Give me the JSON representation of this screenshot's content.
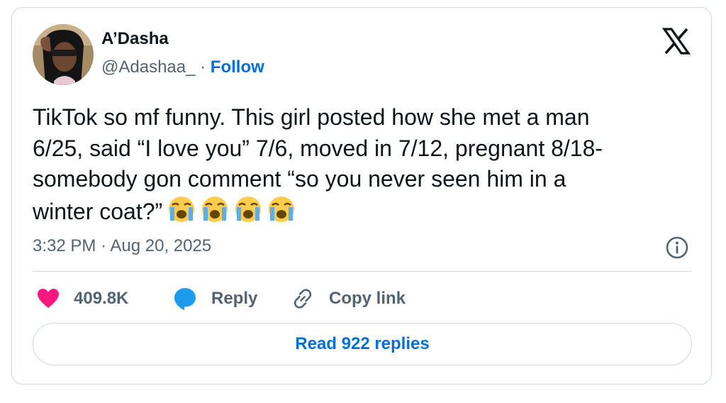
{
  "author": {
    "display_name": "A’Dasha",
    "handle": "@Adashaa_",
    "separator": " · ",
    "follow_label": "Follow"
  },
  "brand_icon": "x-logo-icon",
  "tweet": {
    "text": "TikTok so mf funny. This girl posted how she met a man\n6/25, said “I love you” 7/6, moved in 7/12, pregnant 8/18-\nsomebody gon comment “so you never seen him in a\nwinter coat?”",
    "emojis": [
      "loudly-crying-face-icon",
      "loudly-crying-face-icon",
      "loudly-crying-face-icon",
      "loudly-crying-face-icon"
    ],
    "timestamp": "3:32 PM · Aug 20, 2025"
  },
  "actions": {
    "like_count": "409.8K",
    "reply_label": "Reply",
    "copy_label": "Copy link"
  },
  "read_replies_label": "Read 922 replies",
  "colors": {
    "text_primary": "#0f1419",
    "text_secondary": "#536471",
    "link_blue": "#006fd6",
    "like_pink": "#f91880",
    "reply_blue": "#1d9bf0",
    "border": "#cfd9de"
  }
}
